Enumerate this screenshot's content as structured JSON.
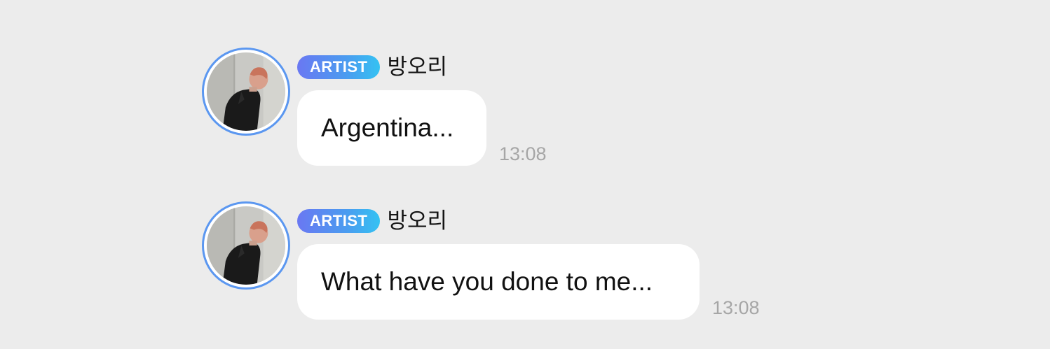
{
  "messages": [
    {
      "badge": "ARTIST",
      "sender": "방오리",
      "text": "Argentina...",
      "time": "13:08",
      "avatar_icon": "profile-photo"
    },
    {
      "badge": "ARTIST",
      "sender": "방오리",
      "text": "What have you done to me...",
      "time": "13:08",
      "avatar_icon": "profile-photo"
    }
  ],
  "colors": {
    "background": "#ececec",
    "bubble": "#ffffff",
    "avatar_ring": "#5b97f0",
    "badge_gradient_start": "#6a78f2",
    "badge_gradient_end": "#34c2f2",
    "timestamp": "#a6a6a6"
  }
}
